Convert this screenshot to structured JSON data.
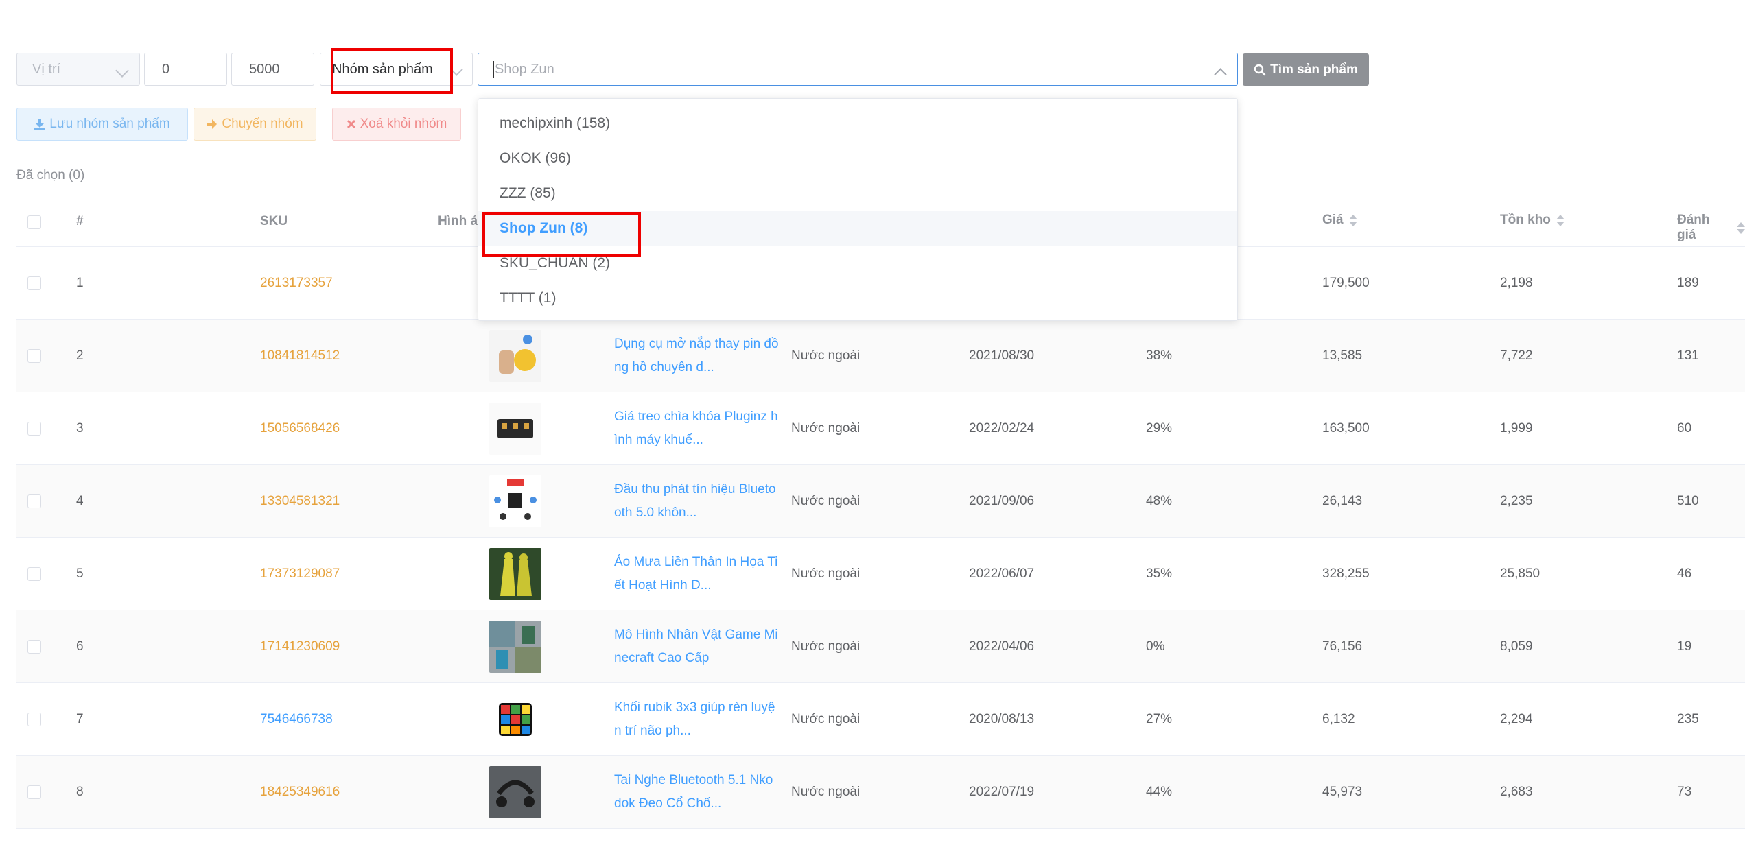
{
  "filters": {
    "position_placeholder": "Vị trí",
    "min_value": "0",
    "max_value": "5000",
    "group_select_label": "Nhóm sản phẩm",
    "shop_select_placeholder": "Shop Zun",
    "find_button": "Tìm sản phẩm"
  },
  "actions": {
    "save_group": "Lưu nhóm sản phẩm",
    "move_group": "Chuyển nhóm",
    "remove_group": "Xoá khỏi nhóm"
  },
  "selected_count": "Đã chọn (0)",
  "table": {
    "headers": {
      "index": "#",
      "sku": "SKU",
      "image": "Hình ả",
      "price": "Giá",
      "stock": "Tồn kho",
      "rating": "Đánh giá"
    },
    "rows": [
      {
        "index": "1",
        "sku": "2613173357",
        "sku_color": "orange",
        "name": "",
        "origin": "",
        "date": "",
        "percent": "",
        "price": "179,500",
        "stock": "2,198",
        "rating": "189"
      },
      {
        "index": "2",
        "sku": "10841814512",
        "sku_color": "orange",
        "name": "Dụng cụ mở nắp thay pin đồng hồ chuyên d...",
        "origin": "Nước ngoài",
        "date": "2021/08/30",
        "percent": "38%",
        "price": "13,585",
        "stock": "7,722",
        "rating": "131"
      },
      {
        "index": "3",
        "sku": "15056568426",
        "sku_color": "orange",
        "name": "Giá treo chìa khóa Pluginz hình máy khuế...",
        "origin": "Nước ngoài",
        "date": "2022/02/24",
        "percent": "29%",
        "price": "163,500",
        "stock": "1,999",
        "rating": "60"
      },
      {
        "index": "4",
        "sku": "13304581321",
        "sku_color": "orange",
        "name": "Đầu thu phát tín hiệu Bluetooth 5.0 khôn...",
        "origin": "Nước ngoài",
        "date": "2021/09/06",
        "percent": "48%",
        "price": "26,143",
        "stock": "2,235",
        "rating": "510"
      },
      {
        "index": "5",
        "sku": "17373129087",
        "sku_color": "orange",
        "name": "Áo Mưa Liền Thân In Họa Tiết Hoạt Hình D...",
        "origin": "Nước ngoài",
        "date": "2022/06/07",
        "percent": "35%",
        "price": "328,255",
        "stock": "25,850",
        "rating": "46"
      },
      {
        "index": "6",
        "sku": "17141230609",
        "sku_color": "orange",
        "name": "Mô Hình Nhân Vật Game Minecraft Cao Cấp",
        "origin": "Nước ngoài",
        "date": "2022/04/06",
        "percent": "0%",
        "price": "76,156",
        "stock": "8,059",
        "rating": "19"
      },
      {
        "index": "7",
        "sku": "7546466738",
        "sku_color": "blue",
        "name": "Khối rubik 3x3 giúp rèn luyện trí não ph...",
        "origin": "Nước ngoài",
        "date": "2020/08/13",
        "percent": "27%",
        "price": "6,132",
        "stock": "2,294",
        "rating": "235"
      },
      {
        "index": "8",
        "sku": "18425349616",
        "sku_color": "orange",
        "name": "Tai Nghe Bluetooth 5.1 Nkodok Đeo Cổ Chố...",
        "origin": "Nước ngoài",
        "date": "2022/07/19",
        "percent": "44%",
        "price": "45,973",
        "stock": "2,683",
        "rating": "73"
      }
    ]
  },
  "dropdown": {
    "options": [
      {
        "label": "mechipxinh (158)",
        "active": false
      },
      {
        "label": "OKOK (96)",
        "active": false
      },
      {
        "label": "ZZZ (85)",
        "active": false
      },
      {
        "label": "Shop Zun (8)",
        "active": true
      },
      {
        "label": "SKU_CHUAN (2)",
        "active": false
      },
      {
        "label": "TTTT (1)",
        "active": false
      }
    ]
  },
  "colors": {
    "accent_blue": "#409eff",
    "sku_orange": "#e6a23c",
    "highlight_red": "#ee0000",
    "find_button_gray": "#8e9196"
  }
}
